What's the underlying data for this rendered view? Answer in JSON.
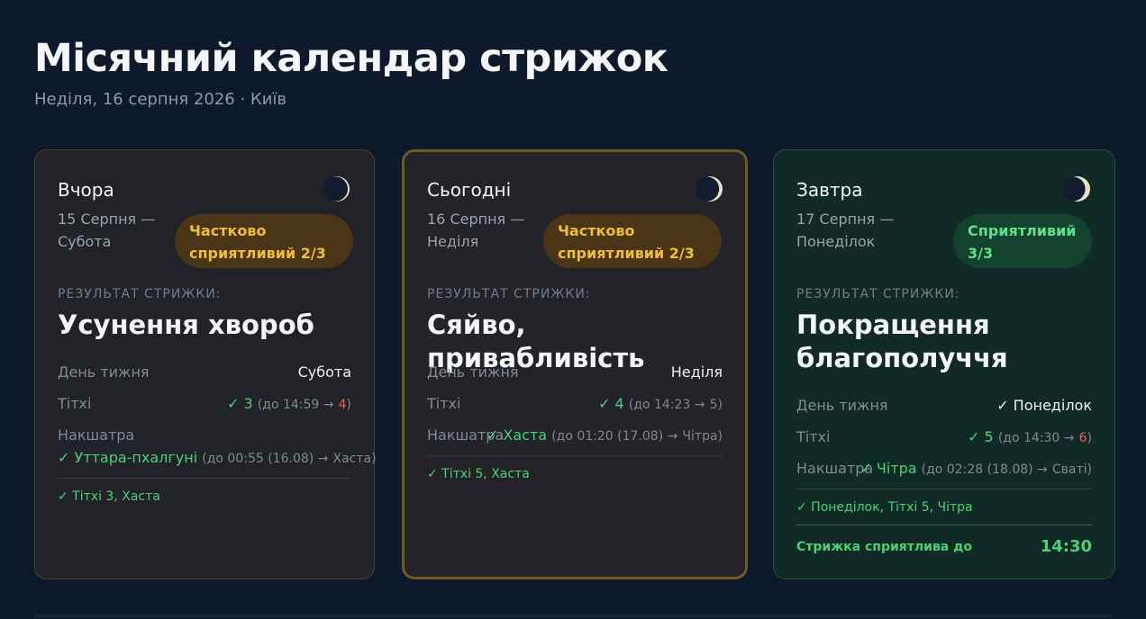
{
  "page": {
    "title": "Місячний календар стрижок",
    "subtitle": "Неділя, 16 серпня 2026 · Київ"
  },
  "cards": [
    {
      "day_name": "Вчора",
      "date_line1": "15 Серпня —",
      "date_line2": "Субота",
      "badge_line1": "Частково",
      "badge_line2": "сприятливий 2/3",
      "result_label": "РЕЗУЛЬТАТ СТРИЖКИ:",
      "result": "Усунення хвороб",
      "weekday_label": "День тижня",
      "weekday_value": "Субота",
      "tithi_label": "Тітхі",
      "tithi_check": "✓ 3",
      "tithi_until": "(до 14:59 →",
      "tithi_next": "4",
      "tithi_close": ")",
      "nak_label": "Накшатра",
      "nak_check": "✓ Уттара-пхалгуні",
      "nak_until": "(до 00:55 (16.08) →",
      "nak_next": "Хаста",
      "nak_close": ")",
      "summary": "✓ Тітхі 3, Хаста"
    },
    {
      "day_name": "Сьогодні",
      "date_line1": "16 Серпня —",
      "date_line2": "Неділя",
      "badge_line1": "Частково",
      "badge_line2": "сприятливий 2/3",
      "result_label": "РЕЗУЛЬТАТ СТРИЖКИ:",
      "result": "Сяйво, привабливість",
      "weekday_label": "День тижня",
      "weekday_value": "Неділя",
      "tithi_label": "Тітхі",
      "tithi_check": "✓ 4",
      "tithi_until": "(до 14:23 →",
      "tithi_next": "5",
      "tithi_close": ")",
      "nak_label": "Накшатра",
      "nak_check": "✓ Хаста",
      "nak_until": "(до 01:20 (17.08) →",
      "nak_next": "Чітра",
      "nak_close": ")",
      "summary": "✓ Тітхі 5, Хаста"
    },
    {
      "day_name": "Завтра",
      "date_line1": "17 Серпня —",
      "date_line2": "Понеділок",
      "badge_line1": "Сприятливий",
      "badge_line2": "3/3",
      "result_label": "РЕЗУЛЬТАТ СТРИЖКИ:",
      "result_line1": "Покращення",
      "result_line2": "благополуччя",
      "weekday_label": "День тижня",
      "weekday_value": "✓ Понеділок",
      "tithi_label": "Тітхі",
      "tithi_check": "✓ 5",
      "tithi_until": "(до 14:30 →",
      "tithi_next": "6",
      "tithi_close": ")",
      "nak_label": "Накшатра",
      "nak_check": "✓ Чітра",
      "nak_until": "(до 02:28 (18.08) →",
      "nak_next": "Сваті",
      "nak_close": ")",
      "summary": "✓ Понеділок, Тітхі 5, Чітра",
      "footer_label": "Стрижка сприятлива до",
      "footer_value": "14:30"
    }
  ],
  "icons": {
    "moon": "moon-phase-icon"
  },
  "colors": {
    "background": "#0e1a2c",
    "good": "#49d17a",
    "partial": "#f0bc3e",
    "bad": "#ef5a5a",
    "today_border": "#6e5b24"
  }
}
